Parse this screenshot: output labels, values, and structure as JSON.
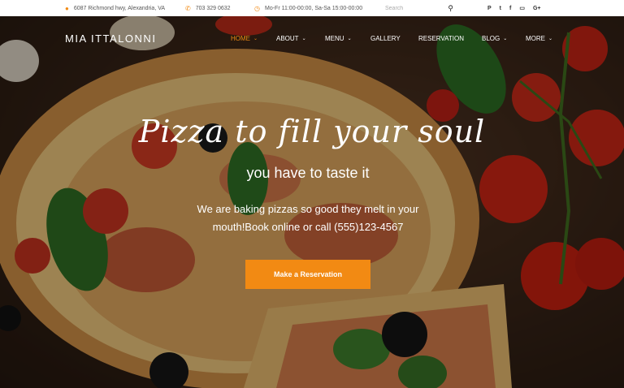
{
  "topbar": {
    "address": "6087 Richmond hwy, Alexandria, VA",
    "phone": "703 329 0632",
    "hours": "Mo-Fr 11:00-00:00, Sa-Sa 15:00-00:00",
    "search_placeholder": "Search",
    "socials": [
      "P",
      "t",
      "f",
      "▭",
      "G+"
    ]
  },
  "header": {
    "logo": "MIA ITTALONNI",
    "nav": [
      {
        "label": "HOME",
        "dropdown": true,
        "active": true
      },
      {
        "label": "ABOUT",
        "dropdown": true
      },
      {
        "label": "MENU",
        "dropdown": true
      },
      {
        "label": "GALLERY",
        "dropdown": false
      },
      {
        "label": "RESERVATION",
        "dropdown": false
      },
      {
        "label": "BLOG",
        "dropdown": true
      },
      {
        "label": "MORE",
        "dropdown": true
      }
    ]
  },
  "hero": {
    "headline": "Pizza to fill your soul",
    "subheadline": "you have to taste it",
    "body_line1": "We are baking pizzas so good they melt in your",
    "body_line2": "mouth!Book online or call (555)123-4567",
    "cta_label": "Make a Reservation"
  },
  "colors": {
    "accent": "#f28a13"
  },
  "icons": {
    "address": "map-pin-icon",
    "phone": "phone-icon",
    "hours": "clock-icon",
    "search": "search-icon"
  }
}
